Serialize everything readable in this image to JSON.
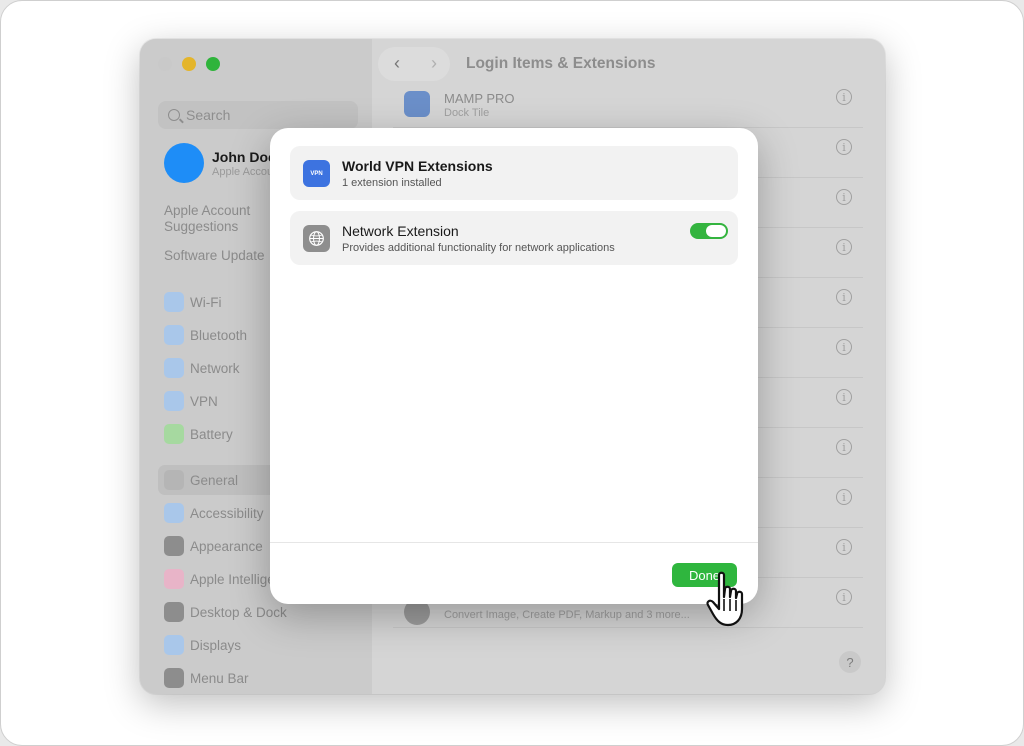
{
  "window": {
    "title": "Login Items & Extensions"
  },
  "sidebar": {
    "search_placeholder": "Search",
    "user": {
      "name": "John Doe",
      "subtitle": "Apple Account"
    },
    "links": [
      "Apple Account",
      "Suggestions",
      "Software Update"
    ],
    "items": [
      {
        "label": "Wi-Fi",
        "icon": "wifi-icon",
        "color": "#a9c7ea"
      },
      {
        "label": "Bluetooth",
        "icon": "bluetooth-icon",
        "color": "#a9c7ea"
      },
      {
        "label": "Network",
        "icon": "globe-icon",
        "color": "#a9c7ea"
      },
      {
        "label": "VPN",
        "icon": "vpn-globe-icon",
        "color": "#a9c7ea"
      },
      {
        "label": "Battery",
        "icon": "battery-icon",
        "color": "#a6d9a0"
      },
      {
        "label": "General",
        "icon": "gear-icon",
        "color": "#b5b5b5"
      },
      {
        "label": "Accessibility",
        "icon": "accessibility-icon",
        "color": "#a9c7ea"
      },
      {
        "label": "Appearance",
        "icon": "appearance-icon",
        "color": "#8d8d8d"
      },
      {
        "label": "Apple Intelligence",
        "icon": "apple-intelligence-icon",
        "color": "#e8b4c8"
      },
      {
        "label": "Desktop & Dock",
        "icon": "dock-icon",
        "color": "#8d8d8d"
      },
      {
        "label": "Displays",
        "icon": "sun-icon",
        "color": "#a9c7ea"
      },
      {
        "label": "Menu Bar",
        "icon": "menubar-icon",
        "color": "#8d8d8d"
      }
    ]
  },
  "content": {
    "rows": [
      {
        "title": "MAMP PRO",
        "subtitle": "Dock Tile"
      },
      {
        "title": "",
        "subtitle": "Convert Image, Create PDF, Markup and 3 more..."
      }
    ],
    "help_label": "?"
  },
  "modal": {
    "extension_title": "World VPN Extensions",
    "extension_subtitle": "1 extension installed",
    "vpn_badge": "VPN",
    "network": {
      "title": "Network Extension",
      "subtitle": "Provides additional functionality for network applications",
      "enabled": true
    },
    "done_label": "Done"
  },
  "colors": {
    "accent_green": "#2fb63e",
    "avatar_blue": "#1e8df7",
    "vpn_blue": "#3d73e0"
  }
}
